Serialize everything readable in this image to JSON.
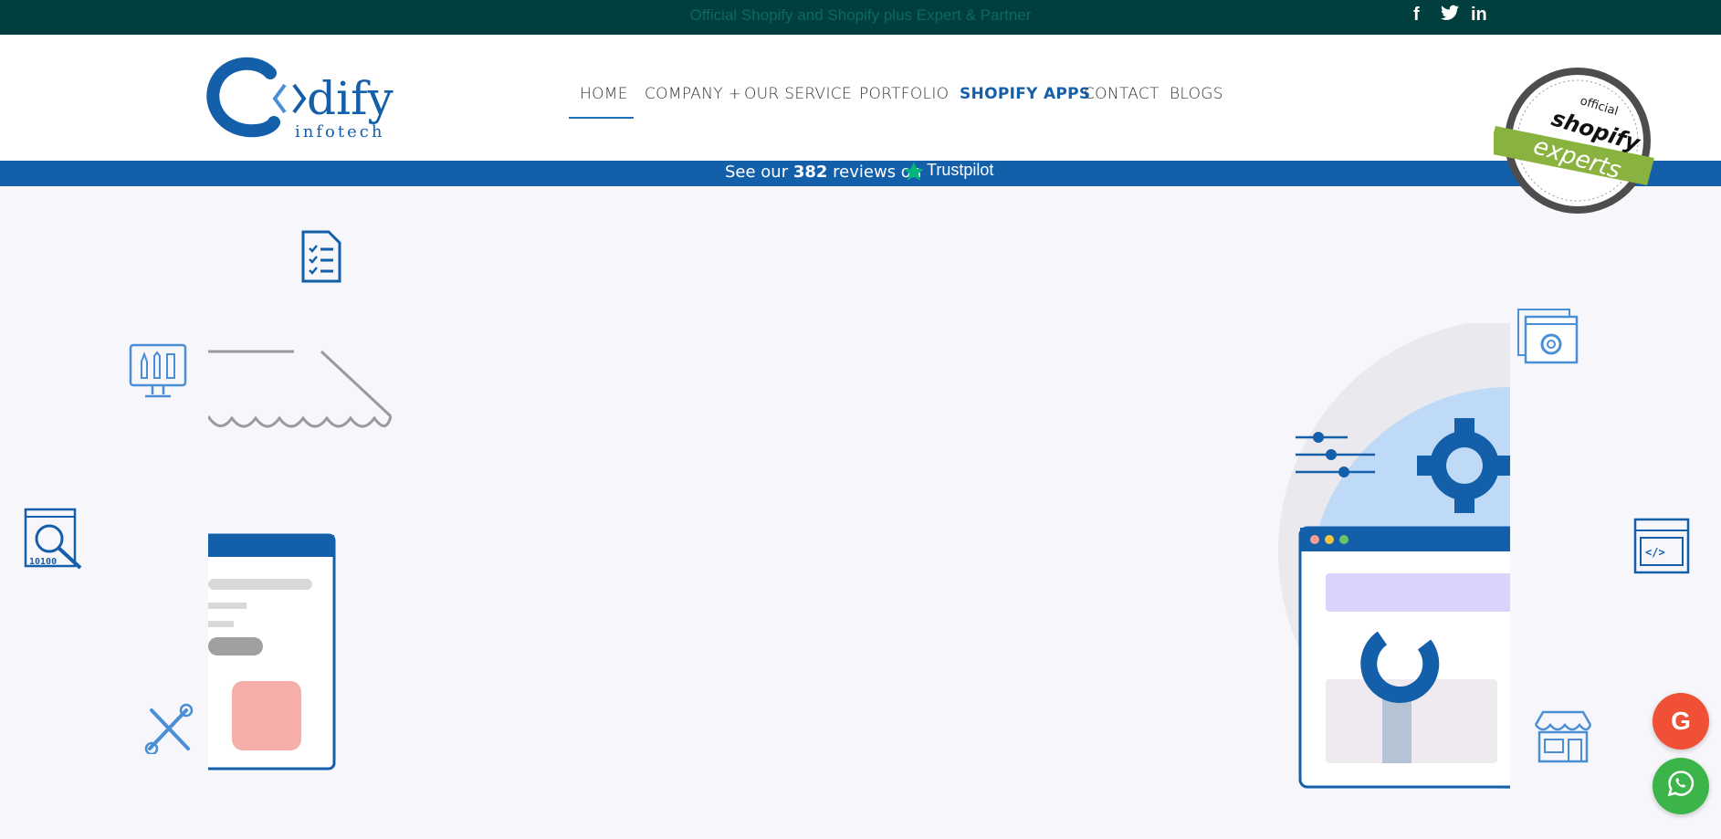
{
  "topbar": {
    "tagline": "Official Shopify and Shopify plus Expert & Partner",
    "social": [
      {
        "icon": "facebook-icon",
        "glyph": "f"
      },
      {
        "icon": "twitter-icon",
        "glyph": "t"
      },
      {
        "icon": "linkedin-icon",
        "glyph": "in"
      }
    ]
  },
  "logo": {
    "brand": "C<>dify",
    "sub": "infotech"
  },
  "nav": {
    "items": [
      {
        "label": "HOME"
      },
      {
        "label": "COMPANY +"
      },
      {
        "label": "OUR SERVICE"
      },
      {
        "label": "PORTFOLIO"
      },
      {
        "label": "SHOPIFY APPS"
      },
      {
        "label": "CONTACT"
      },
      {
        "label": "BLOGS"
      }
    ]
  },
  "trustbar": {
    "prefix": "See our",
    "count": "382",
    "suffix": "reviews on",
    "brand": "Trustpilot"
  },
  "seal": {
    "line1": "official",
    "line2": "shopify",
    "line3": "experts"
  },
  "fab": {
    "google_glyph": "G",
    "whatsapp_glyph": "✆"
  },
  "colors": {
    "topbar": "#003f3d",
    "brand_blue": "#145fa9",
    "google": "#f05136",
    "whatsapp": "#3bb54a"
  }
}
